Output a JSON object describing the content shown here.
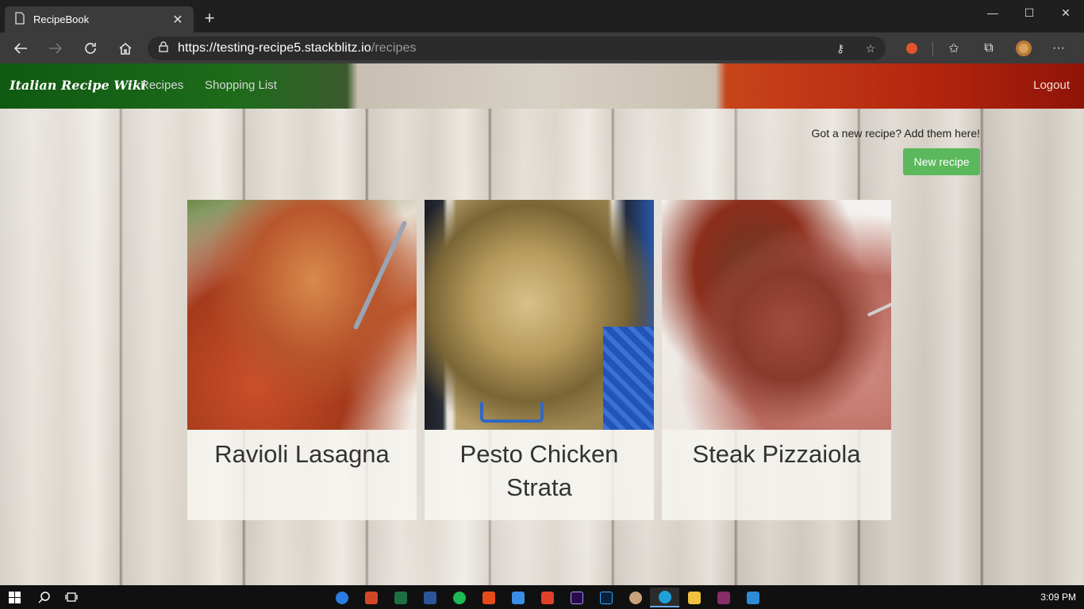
{
  "browser": {
    "tab_title": "RecipeBook",
    "tab_close": "✕",
    "new_tab": "+",
    "url_main": "https://testing-recipe5.stackblitz.io",
    "url_path": "/recipes",
    "window_controls": {
      "minimize": "—",
      "maximize": "☐",
      "close": "✕"
    }
  },
  "navbar": {
    "brand": "Italian Recipe Wiki",
    "links": [
      "Recipes",
      "Shopping List"
    ],
    "logout": "Logout"
  },
  "main": {
    "hint": "Got a new recipe? Add them here!",
    "new_recipe_label": "New recipe",
    "recipes": [
      {
        "name": "Ravioli Lasagna"
      },
      {
        "name": "Pesto Chicken Strata"
      },
      {
        "name": "Steak Pizzaiola"
      }
    ]
  },
  "taskbar": {
    "time": "3:09 PM"
  },
  "colors": {
    "primary_button": "#5cb85c",
    "flag_green": "#1e6b1a",
    "flag_red": "#b5260f"
  }
}
